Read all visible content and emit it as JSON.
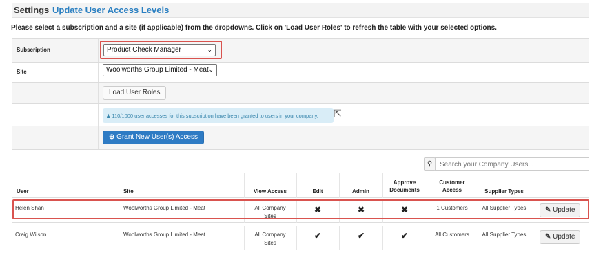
{
  "header": {
    "title": "Settings",
    "subtitle": "Update User Access Levels"
  },
  "instructions": "Please select a subscription and a site (if applicable) from the dropdowns. Click on 'Load User Roles' to refresh the table with your selected options.",
  "form": {
    "subscription_label": "Subscription",
    "subscription_value": "Product Check Manager",
    "site_label": "Site",
    "site_value": "Woolworths Group Limited - Meat",
    "load_button": "Load User Roles",
    "info_text": "110/1000 user accesses for this subscription have been granted to users in your company.",
    "grant_button": "Grant New User(s) Access"
  },
  "search": {
    "placeholder": "Search your Company Users..."
  },
  "table": {
    "columns": {
      "user": "User",
      "site": "Site",
      "view_access": "View Access",
      "edit": "Edit",
      "admin": "Admin",
      "approve_1": "Approve",
      "approve_2": "Documents",
      "customer_1": "Customer",
      "customer_2": "Access",
      "supplier_types": "Supplier Types"
    },
    "rows": [
      {
        "user": "Helen Shan",
        "site": "Woolworths Group Limited - Meat",
        "view_1": "All Company",
        "view_2": "Sites",
        "edit": "✖",
        "admin": "✖",
        "approve": "✖",
        "customer_access": "1 Customers",
        "supplier_types": "All Supplier Types",
        "update": "Update"
      },
      {
        "user": "Craig Wilson",
        "site": "Woolworths Group Limited - Meat",
        "view_1": "All Company",
        "view_2": "Sites",
        "edit": "✔",
        "admin": "✔",
        "approve": "✔",
        "customer_access": "All Customers",
        "supplier_types": "All Supplier Types",
        "update": "Update"
      }
    ]
  },
  "colors": {
    "accent": "#2a7fc1",
    "highlight": "#d9534f",
    "primary_button": "#2e7bc4",
    "info_bg": "#d9edf7"
  },
  "icons": {
    "caret": "chevron-down-icon",
    "user": "user-icon",
    "plus": "plus-circle-icon",
    "search": "search-icon",
    "edit": "edit-icon",
    "cursor": "mouse-pointer-icon"
  }
}
